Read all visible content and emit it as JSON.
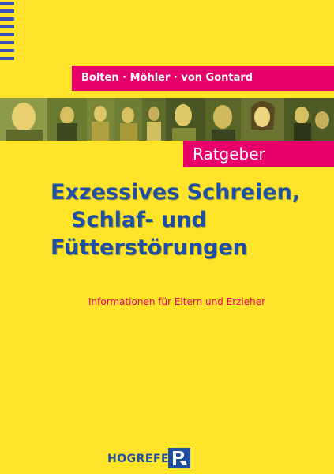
{
  "authors": "Bolten · Möhler · von Gontard",
  "series_label": "Ratgeber",
  "title_lines": [
    "Exzessives Schreien,",
    "Schlaf- und",
    "Fütterstörungen"
  ],
  "subtitle": "Informationen für Eltern und Erzieher",
  "publisher": "HOGREFE",
  "colors": {
    "background": "#ffe42a",
    "accent_magenta": "#e8006a",
    "title_blue": "#1f4fa3",
    "stripe_blue": "#3b4fb8"
  }
}
